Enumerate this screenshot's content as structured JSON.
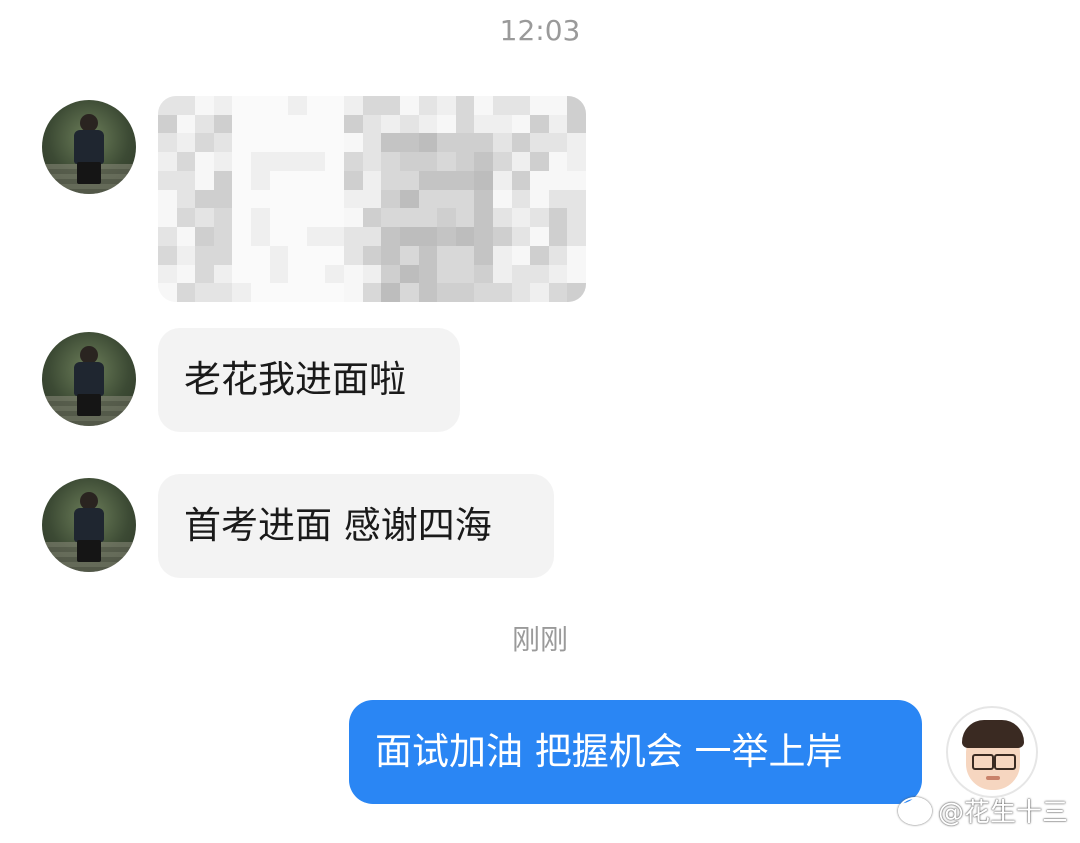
{
  "chat": {
    "timestamps": [
      "12:03",
      "刚刚"
    ],
    "incoming": [
      {
        "type": "image",
        "content": "blurred-image"
      },
      {
        "type": "text",
        "text": "老花我进面啦"
      },
      {
        "type": "text",
        "text": "首考进面 感谢四海"
      }
    ],
    "outgoing": [
      {
        "type": "text",
        "text": "面试加油 把握机会 一举上岸"
      }
    ]
  },
  "watermark": {
    "text": "@花生十三",
    "icon": "weibo-icon"
  },
  "colors": {
    "outgoing_bubble": "#2a86f4",
    "incoming_bubble": "#f3f3f3",
    "timestamp": "#9a9a9a"
  }
}
